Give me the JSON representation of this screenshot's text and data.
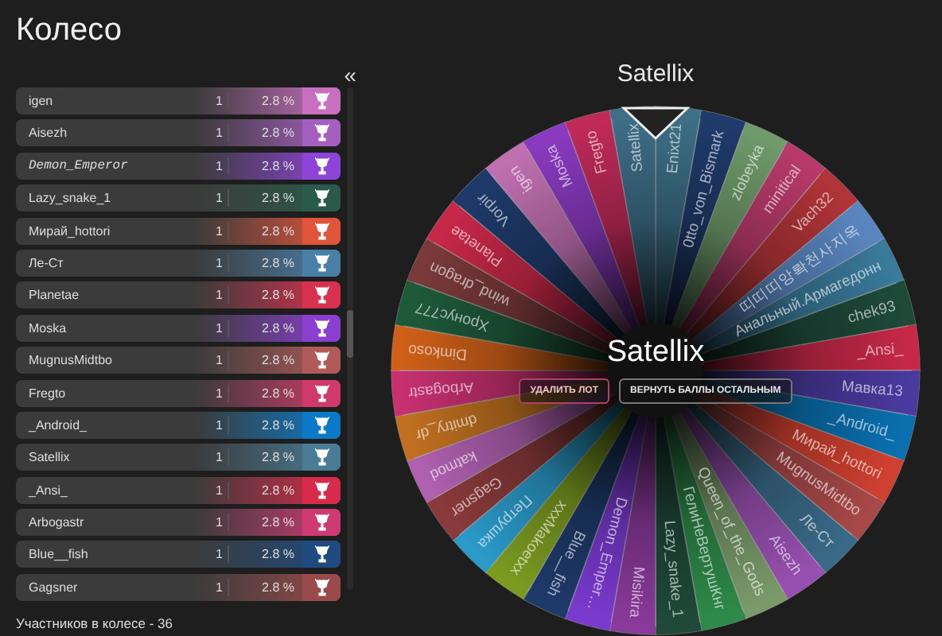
{
  "title": "Колесо",
  "collapse_button": "«",
  "participants": [
    {
      "name": "igen",
      "count": "1",
      "share": "2.8 %",
      "color": "#c86fc0",
      "kind": "plain"
    },
    {
      "name": "Aisezh",
      "count": "1",
      "share": "2.8 %",
      "color": "#a55fc0",
      "kind": "plain"
    },
    {
      "name": "Demon_Emperor",
      "count": "1",
      "share": "2.8 %",
      "color": "#8e44d8",
      "kind": "fancy"
    },
    {
      "name": "Lazy_snake_1",
      "count": "1",
      "share": "2.8 %",
      "color": "#2a5a4a",
      "kind": "plain"
    },
    {
      "name": "Мирай_hottori",
      "count": "1",
      "share": "2.8 %",
      "color": "#e0553a",
      "kind": "plain"
    },
    {
      "name": "Ле-Ст",
      "count": "1",
      "share": "2.8 %",
      "color": "#4a7fa8",
      "kind": "plain"
    },
    {
      "name": "Planetae",
      "count": "1",
      "share": "2.8 %",
      "color": "#d8304f",
      "kind": "plain"
    },
    {
      "name": "Moska",
      "count": "1",
      "share": "2.8 %",
      "color": "#8a3fd0",
      "kind": "plain"
    },
    {
      "name": "MugnusMidtbo",
      "count": "1",
      "share": "2.8 %",
      "color": "#b05a5a",
      "kind": "plain"
    },
    {
      "name": "Fregto",
      "count": "1",
      "share": "2.8 %",
      "color": "#d03a6a",
      "kind": "plain"
    },
    {
      "name": "_Android_",
      "count": "1",
      "share": "2.8 %",
      "color": "#0a7ac8",
      "kind": "plain"
    },
    {
      "name": "Satellix",
      "count": "1",
      "share": "2.8 %",
      "color": "#4a7c96",
      "kind": "plain"
    },
    {
      "name": "_Ansi_",
      "count": "1",
      "share": "2.8 %",
      "color": "#d82a4a",
      "kind": "plain"
    },
    {
      "name": "Arbogastr",
      "count": "1",
      "share": "2.8 %",
      "color": "#d03a72",
      "kind": "plain"
    },
    {
      "name": "Blue__fish",
      "count": "1",
      "share": "2.8 %",
      "color": "#1e4a80",
      "kind": "plain"
    },
    {
      "name": "Gagsner",
      "count": "1",
      "share": "2.8 %",
      "color": "#9a4a4a",
      "kind": "plain"
    }
  ],
  "footer": "Участников в колесе - 36",
  "winner_title": "Satellix",
  "wheel": {
    "center_label": "Satellix",
    "delete_button": "УДАЛИТЬ ЛОТ",
    "return_button": "ВЕРНУТЬ БАЛЛЫ ОСТАЛЬНЫМ",
    "slices": [
      {
        "label": "Enixt21",
        "color": "#3d6f86"
      },
      {
        "label": "0tto_von_Bismark",
        "color": "#1f3b6b"
      },
      {
        "label": "zlobeyka",
        "color": "#6f9a6a"
      },
      {
        "label": "minitical",
        "color": "#b83a6a"
      },
      {
        "label": "Vach32",
        "color": "#b03438"
      },
      {
        "label": "띠띠띠앙롹천사지옥",
        "color": "#5a86c0"
      },
      {
        "label": "Анальный.Армагедонн",
        "color": "#3a7a9a"
      },
      {
        "label": "chek93",
        "color": "#1e4a3a"
      },
      {
        "label": "_Ansi_",
        "color": "#c82848"
      },
      {
        "label": "Мавка13",
        "color": "#4a3aa0"
      },
      {
        "label": "_Android_",
        "color": "#0a70b0"
      },
      {
        "label": "Мирай_hottori",
        "color": "#d04030"
      },
      {
        "label": "MugnusMidtbo",
        "color": "#a84848"
      },
      {
        "label": "Ле-Ст",
        "color": "#3a6a88"
      },
      {
        "label": "Aisezh",
        "color": "#9850b0"
      },
      {
        "label": "Queen_of_the_Gods",
        "color": "#7a9a6a"
      },
      {
        "label": "ГелиНеВертушКнг",
        "color": "#2e8a4a"
      },
      {
        "label": "Lazy_snake_1",
        "color": "#1f4a3a"
      },
      {
        "label": "Misikira",
        "color": "#8a3a9a"
      },
      {
        "label": "Demon_Emper…",
        "color": "#7a3ad0"
      },
      {
        "label": "Blue__fish",
        "color": "#1e3a6a"
      },
      {
        "label": "xxxMakoetxx",
        "color": "#7a9a20"
      },
      {
        "label": "Петрушка",
        "color": "#2a9ac8"
      },
      {
        "label": "Gagsner",
        "color": "#8a3a3a"
      },
      {
        "label": "katmod",
        "color": "#b060b0"
      },
      {
        "label": "dmitry_dr",
        "color": "#c07020"
      },
      {
        "label": "Arbogastr",
        "color": "#c83070"
      },
      {
        "label": "Dimkoso",
        "color": "#d06018"
      },
      {
        "label": "Хронус777",
        "color": "#1e5a3a"
      },
      {
        "label": "wind_dragon",
        "color": "#7a3a3a"
      },
      {
        "label": "Planetae",
        "color": "#c82848"
      },
      {
        "label": "Vorpir",
        "color": "#1e3a6a"
      },
      {
        "label": "igen",
        "color": "#c070b0"
      },
      {
        "label": "Moska",
        "color": "#8a3ac0"
      },
      {
        "label": "Fregto",
        "color": "#c02a5a"
      },
      {
        "label": "Satellix",
        "color": "#3e6e88"
      }
    ]
  }
}
